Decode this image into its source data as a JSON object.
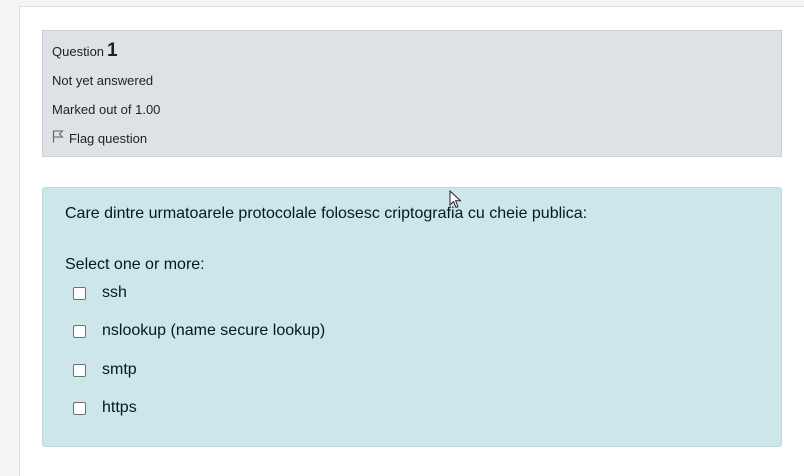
{
  "question_info": {
    "question_label": "Question",
    "question_number": "1",
    "state": "Not yet answered",
    "grade": "Marked out of 1.00",
    "flag_label": "Flag question"
  },
  "question": {
    "text": "Care dintre urmatoarele protocolale folosesc criptografia cu cheie publica:",
    "prompt": "Select one or more:",
    "options": [
      {
        "label": "ssh",
        "checked": false
      },
      {
        "label": "nslookup (name secure lookup)",
        "checked": false
      },
      {
        "label": "smtp",
        "checked": false
      },
      {
        "label": "https",
        "checked": false
      }
    ]
  },
  "colors": {
    "info_bg": "#dee2e6",
    "content_bg": "#cce6ea",
    "page_bg": "#ffffff"
  }
}
